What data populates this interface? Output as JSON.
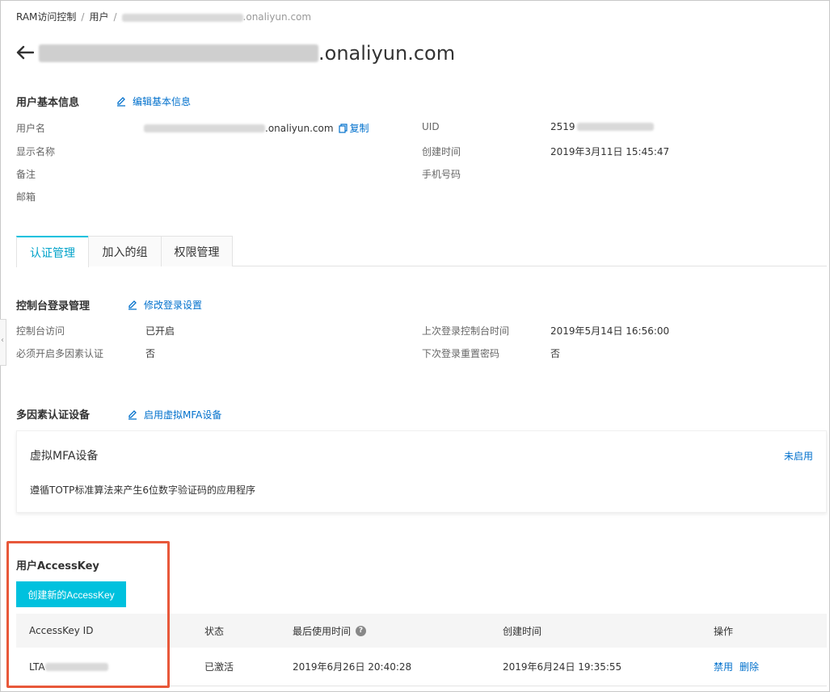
{
  "breadcrumb": {
    "root": "RAM访问控制",
    "users": "用户",
    "sep": "/",
    "current_suffix": ".onaliyun.com"
  },
  "header": {
    "back_icon": "arrow-left-icon",
    "title_suffix": ".onaliyun.com"
  },
  "basic_info": {
    "section_title": "用户基本信息",
    "edit_label": "编辑基本信息",
    "username_label": "用户名",
    "username_suffix": ".onaliyun.com",
    "copy_label": "复制",
    "display_name_label": "显示名称",
    "remark_label": "备注",
    "email_label": "邮箱",
    "uid_label": "UID",
    "uid_prefix": "2519",
    "created_label": "创建时间",
    "created_value": "2019年3月11日 15:45:47",
    "phone_label": "手机号码"
  },
  "tabs": [
    {
      "label": "认证管理",
      "active": true
    },
    {
      "label": "加入的组",
      "active": false
    },
    {
      "label": "权限管理",
      "active": false
    }
  ],
  "console_login": {
    "section_title": "控制台登录管理",
    "edit_label": "修改登录设置",
    "access_label": "控制台访问",
    "access_value": "已开启",
    "mfa_required_label": "必须开启多因素认证",
    "mfa_required_value": "否",
    "last_login_label": "上次登录控制台时间",
    "last_login_value": "2019年5月14日 16:56:00",
    "reset_pwd_label": "下次登录重置密码",
    "reset_pwd_value": "否"
  },
  "mfa": {
    "section_title": "多因素认证设备",
    "enable_label": "启用虚拟MFA设备",
    "card_title": "虚拟MFA设备",
    "card_status": "未启用",
    "card_desc": "遵循TOTP标准算法来产生6位数字验证码的应用程序"
  },
  "access_key": {
    "section_title": "用户AccessKey",
    "create_button": "创建新的AccessKey",
    "columns": {
      "id": "AccessKey ID",
      "status": "状态",
      "last_used": "最后使用时间",
      "created": "创建时间",
      "actions": "操作"
    },
    "rows": [
      {
        "id_prefix": "LTA",
        "status": "已激活",
        "last_used": "2019年6月26日 20:40:28",
        "created": "2019年6月24日 19:35:55",
        "action_disable": "禁用",
        "action_delete": "删除"
      }
    ]
  },
  "colors": {
    "accent": "#00c1de",
    "link": "#0070cc",
    "highlight": "#e8583a"
  }
}
